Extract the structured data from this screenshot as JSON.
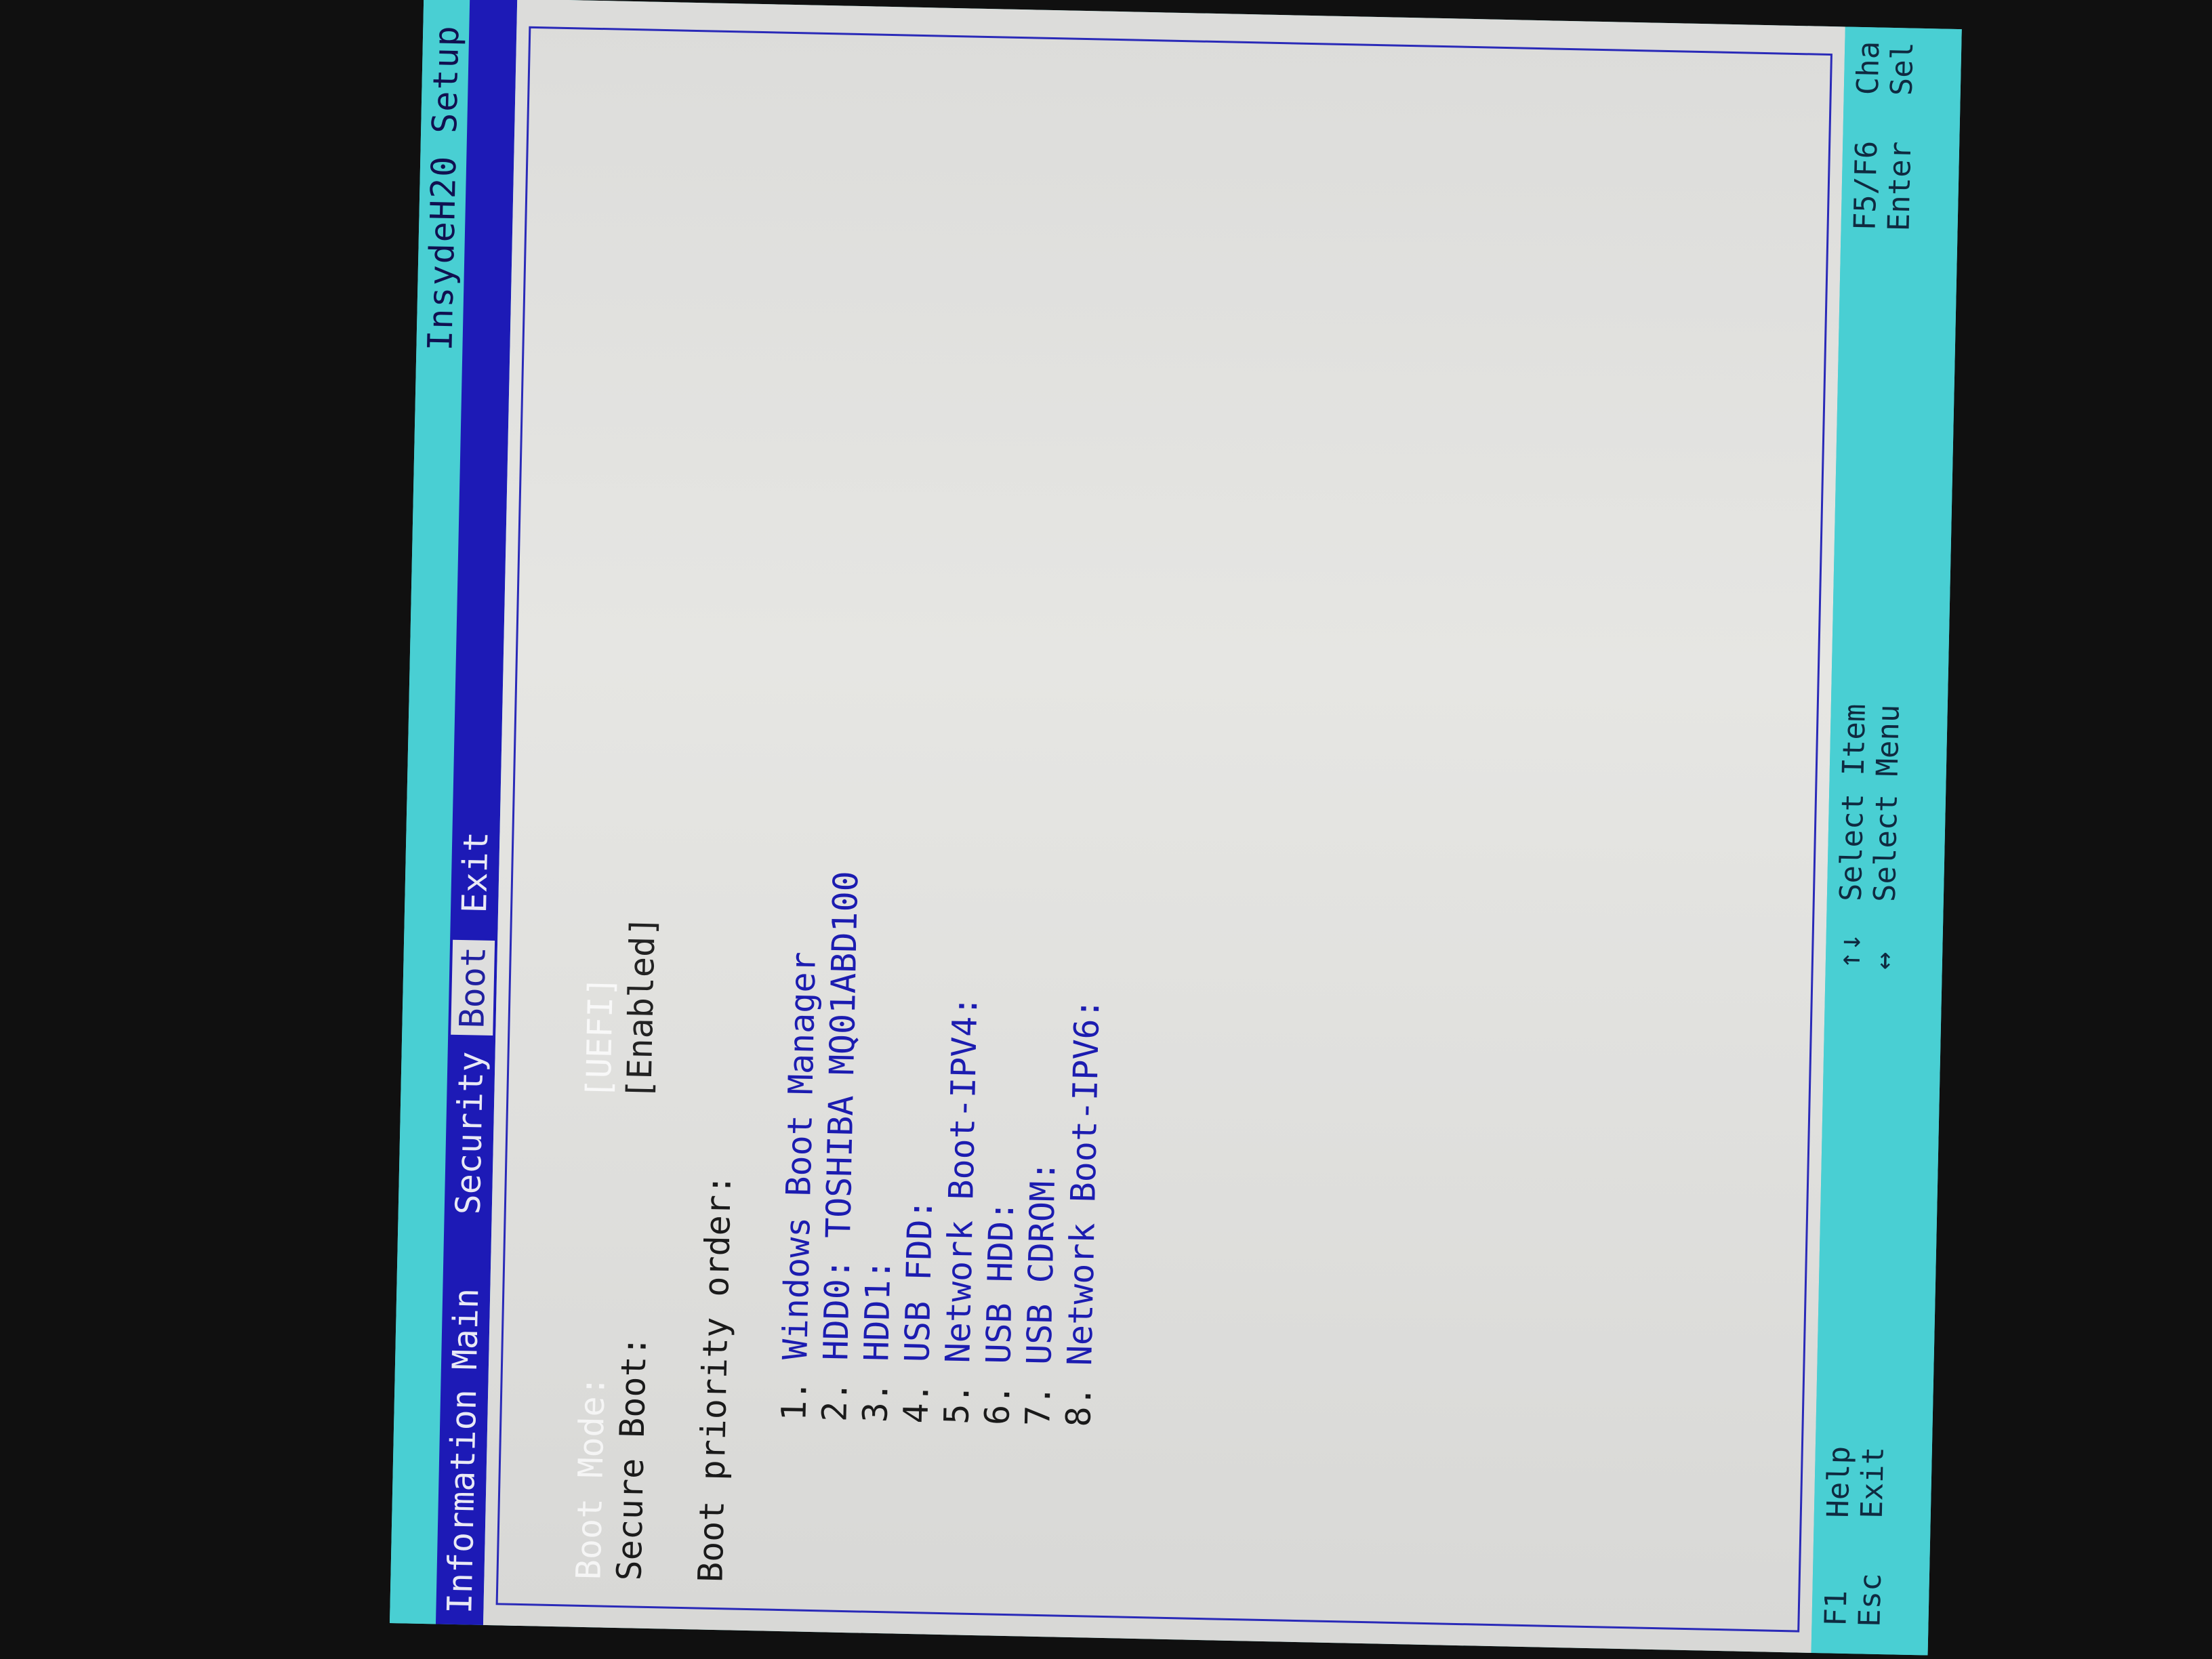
{
  "header": {
    "title": "InsydeH20 Setup"
  },
  "menu": {
    "items": [
      {
        "label": "Information"
      },
      {
        "label": "Main"
      },
      {
        "label": "Security"
      },
      {
        "label": "Boot"
      },
      {
        "label": "Exit"
      }
    ],
    "active": "Boot"
  },
  "settings": {
    "boot_mode": {
      "label": "Boot Mode:",
      "value": "[UEFI]"
    },
    "secure_boot": {
      "label": "Secure Boot:",
      "value": "[Enabled]"
    }
  },
  "boot_priority": {
    "heading": "Boot priority order:",
    "items": [
      {
        "num": "1.",
        "label": "Windows Boot Manager"
      },
      {
        "num": "2.",
        "label": "HDD0: TOSHIBA MQ01ABD100"
      },
      {
        "num": "3.",
        "label": "HDD1:"
      },
      {
        "num": "4.",
        "label": "USB FDD:"
      },
      {
        "num": "5.",
        "label": "Network Boot-IPV4:"
      },
      {
        "num": "6.",
        "label": "USB HDD:"
      },
      {
        "num": "7.",
        "label": "USB CDROM:"
      },
      {
        "num": "8.",
        "label": "Network Boot-IPV6:"
      }
    ]
  },
  "footer": {
    "f1_key": "F1",
    "f1_text": "Help",
    "esc_key": "Esc",
    "esc_text": "Exit",
    "updown_key": "↑↓",
    "updown_text": "Select Item",
    "leftright_key": "↔",
    "leftright_text": "Select Menu",
    "f5f6_key": "F5/F6",
    "f5f6_text": "Cha",
    "enter_key": "Enter",
    "enter_text": "Sel"
  },
  "colors": {
    "menu_bar": "#1d1ab6",
    "header_footer": "#49cfd3",
    "content_bg": "#e2e2df",
    "item_blue": "#1c1cb0"
  }
}
